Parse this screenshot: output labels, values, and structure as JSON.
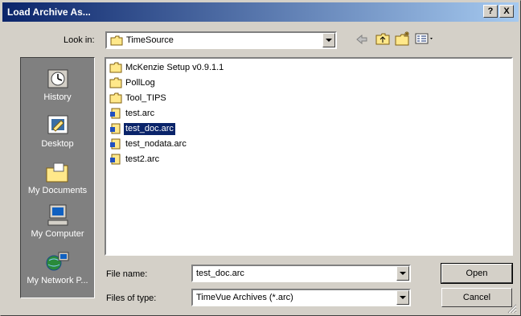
{
  "window": {
    "title": "Load Archive As...",
    "help": "?",
    "close": "X"
  },
  "toolbar": {
    "look_in_label": "Look in:",
    "look_in_value": "TimeSource"
  },
  "places": [
    {
      "label": "History",
      "icon": "history-icon"
    },
    {
      "label": "Desktop",
      "icon": "desktop-icon"
    },
    {
      "label": "My Documents",
      "icon": "my-documents-icon"
    },
    {
      "label": "My Computer",
      "icon": "my-computer-icon"
    },
    {
      "label": "My Network P...",
      "icon": "network-places-icon"
    }
  ],
  "files": [
    {
      "name": "McKenzie Setup v0.9.1.1",
      "kind": "folder"
    },
    {
      "name": "PollLog",
      "kind": "folder"
    },
    {
      "name": "Tool_TIPS",
      "kind": "folder"
    },
    {
      "name": "test.arc",
      "kind": "archive"
    },
    {
      "name": "test_doc.arc",
      "kind": "archive",
      "selected": true
    },
    {
      "name": "test_nodata.arc",
      "kind": "archive"
    },
    {
      "name": "test2.arc",
      "kind": "archive"
    }
  ],
  "form": {
    "file_name_label": "File name:",
    "file_name_value": "test_doc.arc",
    "file_type_label": "Files of type:",
    "file_type_value": "TimeVue Archives (*.arc)"
  },
  "buttons": {
    "open": "Open",
    "cancel": "Cancel"
  },
  "colors": {
    "title_start": "#0a246a",
    "title_end": "#a6caf0",
    "selection": "#0a246a",
    "face": "#d4d0c8"
  }
}
